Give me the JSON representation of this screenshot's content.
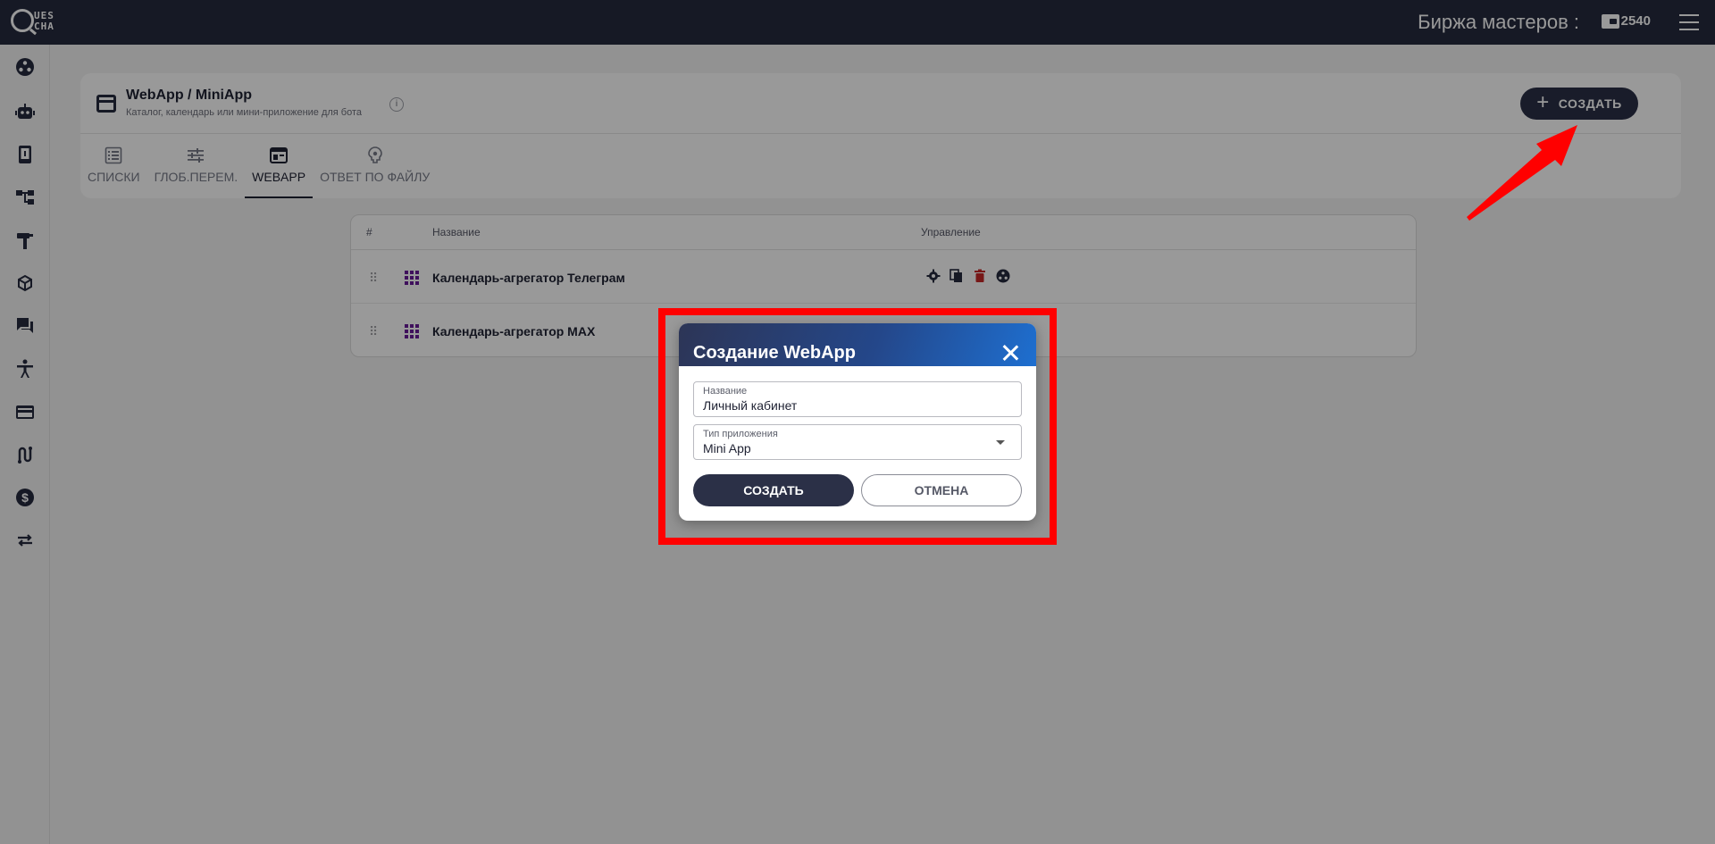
{
  "topbar": {
    "logo_line1": "UES",
    "logo_line2": "CHA",
    "exchange_label": "Биржа мастеров :",
    "balance": "2540"
  },
  "sidebar": {
    "icons": [
      "share-icon",
      "robot-icon",
      "phone-icon",
      "tree-icon",
      "hammer-icon",
      "cube-icon",
      "chat-icon",
      "accessibility-icon",
      "card-icon",
      "route-icon",
      "dollar-icon",
      "swap-icon"
    ]
  },
  "page": {
    "title": "WebApp / MiniApp",
    "subtitle": "Каталог, календарь или мини-приложение для бота",
    "create_button": "СОЗДАТЬ"
  },
  "tabs": [
    {
      "label": "СПИСКИ",
      "icon": "list-icon",
      "active": false
    },
    {
      "label": "ГЛОБ.ПЕРЕМ.",
      "icon": "sliders-icon",
      "active": false
    },
    {
      "label": "WEBAPP",
      "icon": "webapp-icon",
      "active": true
    },
    {
      "label": "ОТВЕТ ПО ФАЙЛУ",
      "icon": "brain-icon",
      "active": false
    }
  ],
  "table": {
    "headers": {
      "num": "#",
      "name": "Название",
      "manage": "Управление"
    },
    "rows": [
      {
        "name": "Календарь-агрегатор Телеграм"
      },
      {
        "name": "Календарь-агрегатор MAX"
      }
    ]
  },
  "dialog": {
    "title": "Создание WebApp",
    "name_label": "Название",
    "name_value": "Личный кабинет",
    "type_label": "Тип приложения",
    "type_value": "Mini App",
    "create_button": "СОЗДАТЬ",
    "cancel_button": "ОТМЕНА"
  },
  "colors": {
    "topbar": "#252a3f",
    "accent": "#2b3047",
    "highlight": "#ff0000",
    "grid_icon": "#6a1b9a",
    "delete": "#c62828"
  }
}
